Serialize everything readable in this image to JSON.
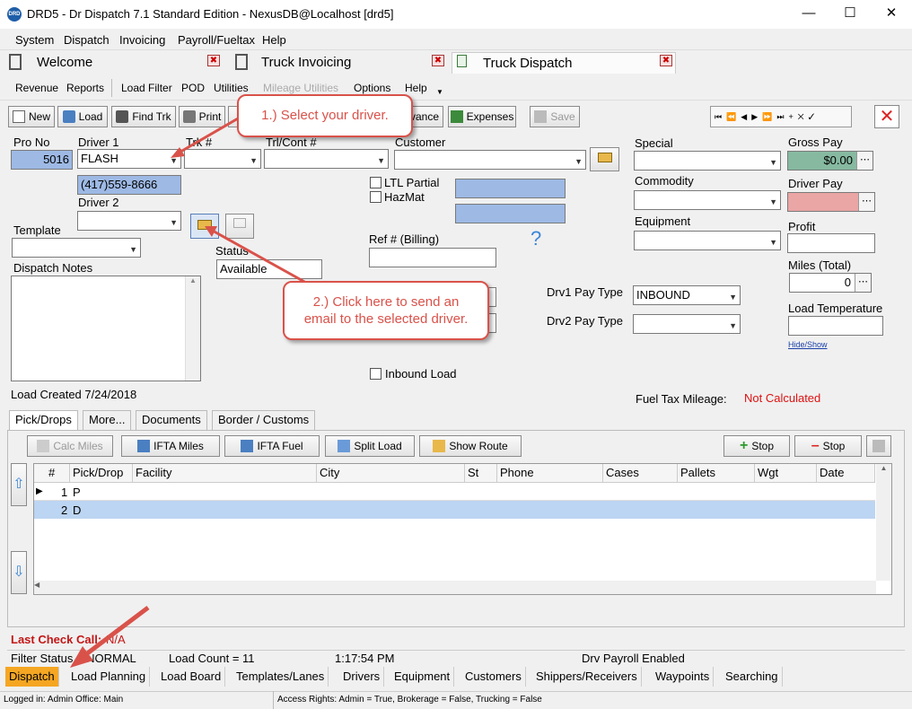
{
  "window": {
    "title": "DRD5 - Dr Dispatch 7.1 Standard Edition - NexusDB@Localhost [drd5]",
    "logo_text": "DRD"
  },
  "menu": [
    "System",
    "Dispatch",
    "Invoicing",
    "Payroll/Fueltax",
    "Help"
  ],
  "doc_tabs": [
    {
      "label": "Welcome"
    },
    {
      "label": "Truck Invoicing"
    },
    {
      "label": "Truck Dispatch"
    }
  ],
  "toolbar": [
    "Revenue",
    "Reports",
    "Load Filter",
    "POD",
    "Utilities",
    "Mileage Utilities",
    "Options",
    "Help"
  ],
  "actions": {
    "new": "New",
    "load": "Load",
    "find": "Find Trk",
    "print": "Print",
    "advance": "vance",
    "expenses": "Expenses",
    "save": "Save"
  },
  "form": {
    "pro_no_label": "Pro No",
    "pro_no": "5016",
    "driver1_label": "Driver 1",
    "driver1": "FLASH",
    "phone": "(417)559-8666",
    "driver2_label": "Driver 2",
    "trk_label": "Trk #",
    "trl_label": "Trl/Cont #",
    "customer_label": "Customer",
    "ltl_label": "LTL Partial",
    "hazmat_label": "HazMat",
    "template_label": "Template",
    "status_label": "Status",
    "status": "Available",
    "ref_label": "Ref # (Billing)",
    "dispatch_notes_label": "Dispatch Notes",
    "inbound_label": "Inbound Load",
    "load_created": "Load Created 7/24/2018",
    "special_label": "Special",
    "commodity_label": "Commodity",
    "equipment_label": "Equipment",
    "drv1_pay_label": "Drv1 Pay Type",
    "drv1_pay": "INBOUND",
    "drv2_pay_label": "Drv2 Pay Type",
    "gross_pay_label": "Gross Pay",
    "gross_pay": "$0.00",
    "driver_pay_label": "Driver Pay",
    "profit_label": "Profit",
    "miles_label": "Miles (Total)",
    "miles": "0",
    "load_temp_label": "Load Temperature",
    "hide_show": "Hide/Show",
    "fuel_tax_label": "Fuel Tax Mileage:",
    "fuel_tax_value": "Not Calculated",
    "help_mark": "?"
  },
  "callouts": {
    "c1": "1.) Select your driver.",
    "c2": "2.) Click here to send an email to the selected driver."
  },
  "bottom_tabs": [
    "Pick/Drops",
    "More...",
    "Documents",
    "Border / Customs"
  ],
  "grid_buttons": {
    "calc": "Calc Miles",
    "ifta_miles": "IFTA Miles",
    "ifta_fuel": "IFTA Fuel",
    "split": "Split Load",
    "route": "Show Route",
    "add_stop": "Stop",
    "del_stop": "Stop"
  },
  "grid": {
    "columns": [
      "#",
      "Pick/Drop",
      "Facility",
      "City",
      "St",
      "Phone",
      "Cases",
      "Pallets",
      "Wgt",
      "Date"
    ],
    "rows": [
      {
        "n": "1",
        "type": "P"
      },
      {
        "n": "2",
        "type": "D"
      }
    ]
  },
  "last_check": {
    "label": "Last Check Call:",
    "value": "N/A"
  },
  "status_bar": {
    "filter": "Filter Status = NORMAL",
    "count": "Load Count = 11",
    "time": "1:17:54 PM",
    "payroll": "Drv Payroll Enabled"
  },
  "app_tabs": [
    "Dispatch",
    "Load Planning",
    "Load Board",
    "Templates/Lanes",
    "Drivers",
    "Equipment",
    "Customers",
    "Shippers/Receivers",
    "Waypoints",
    "Searching"
  ],
  "footer": {
    "login": "Logged in: Admin Office: Main",
    "rights": "Access Rights: Admin = True, Brokerage = False, Trucking = False"
  },
  "colors": {
    "accent_red": "#d9524a",
    "selected_tab": "#f5a623",
    "blue_field": "#9db9e4"
  }
}
